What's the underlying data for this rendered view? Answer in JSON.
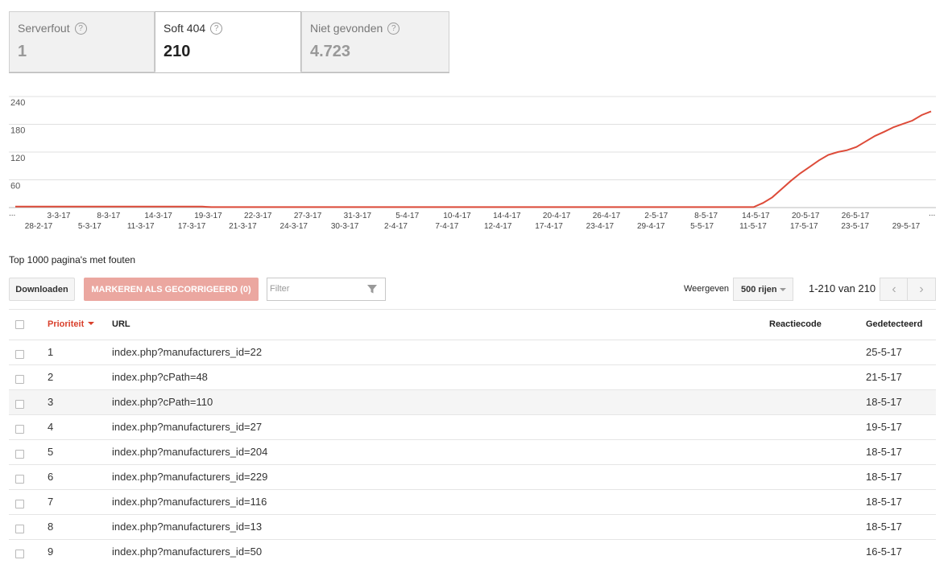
{
  "tabs": [
    {
      "label": "Serverfout",
      "value": "1"
    },
    {
      "label": "Soft 404",
      "value": "210"
    },
    {
      "label": "Niet gevonden",
      "value": "4.723"
    }
  ],
  "chart_data": {
    "type": "line",
    "y_ticks": [
      "240",
      "180",
      "120",
      "60"
    ],
    "ylim": [
      0,
      240
    ],
    "x_ticks_upper": [
      "3-3-17",
      "8-3-17",
      "14-3-17",
      "19-3-17",
      "22-3-17",
      "27-3-17",
      "31-3-17",
      "5-4-17",
      "10-4-17",
      "14-4-17",
      "20-4-17",
      "26-4-17",
      "2-5-17",
      "8-5-17",
      "14-5-17",
      "20-5-17",
      "26-5-17"
    ],
    "x_ticks_lower": [
      "28-2-17",
      "5-3-17",
      "11-3-17",
      "17-3-17",
      "21-3-17",
      "24-3-17",
      "30-3-17",
      "2-4-17",
      "7-4-17",
      "12-4-17",
      "17-4-17",
      "23-4-17",
      "29-4-17",
      "5-5-17",
      "11-5-17",
      "17-5-17",
      "23-5-17",
      "29-5-17"
    ],
    "edge_marks": [
      "...",
      "..."
    ],
    "series": [
      {
        "color": "#dd4b39",
        "values": [
          2,
          2,
          2,
          2,
          2,
          2,
          2,
          2,
          2,
          2,
          2,
          2,
          2,
          2,
          2,
          2,
          2,
          2,
          2,
          2,
          2,
          1,
          1,
          1,
          1,
          1,
          1,
          1,
          1,
          1,
          1,
          1,
          1,
          1,
          1,
          1,
          1,
          1,
          1,
          1,
          1,
          1,
          1,
          1,
          1,
          1,
          1,
          1,
          1,
          1,
          1,
          1,
          1,
          1,
          1,
          1,
          1,
          1,
          1,
          1,
          1,
          1,
          1,
          1,
          1,
          1,
          1,
          1,
          1,
          1,
          1,
          1,
          1,
          1,
          1,
          1,
          1,
          1,
          1,
          1,
          10,
          22,
          40,
          58,
          74,
          88,
          102,
          114,
          120,
          124,
          131,
          143,
          155,
          164,
          174,
          181,
          188,
          200,
          208
        ]
      }
    ]
  },
  "section_title": "Top 1000 pagina's met fouten",
  "toolbar": {
    "download_label": "Downloaden",
    "mark_fixed_label": "MARKEREN ALS GECORRIGEERD (0)",
    "filter_placeholder": "Filter",
    "rows_label": "Weergeven",
    "rows_value": "500 rijen",
    "range_text": "1-210 van 210"
  },
  "table": {
    "headers": {
      "priority": "Prioriteit",
      "url": "URL",
      "code": "Reactiecode",
      "detected": "Gedetecteerd"
    },
    "rows": [
      {
        "priority": "1",
        "url": "index.php?manufacturers_id=22",
        "detected": "25-5-17"
      },
      {
        "priority": "2",
        "url": "index.php?cPath=48",
        "detected": "21-5-17"
      },
      {
        "priority": "3",
        "url": "index.php?cPath=110",
        "detected": "18-5-17"
      },
      {
        "priority": "4",
        "url": "index.php?manufacturers_id=27",
        "detected": "19-5-17"
      },
      {
        "priority": "5",
        "url": "index.php?manufacturers_id=204",
        "detected": "18-5-17"
      },
      {
        "priority": "6",
        "url": "index.php?manufacturers_id=229",
        "detected": "18-5-17"
      },
      {
        "priority": "7",
        "url": "index.php?manufacturers_id=116",
        "detected": "18-5-17"
      },
      {
        "priority": "8",
        "url": "index.php?manufacturers_id=13",
        "detected": "18-5-17"
      },
      {
        "priority": "9",
        "url": "index.php?manufacturers_id=50",
        "detected": "16-5-17"
      }
    ]
  }
}
